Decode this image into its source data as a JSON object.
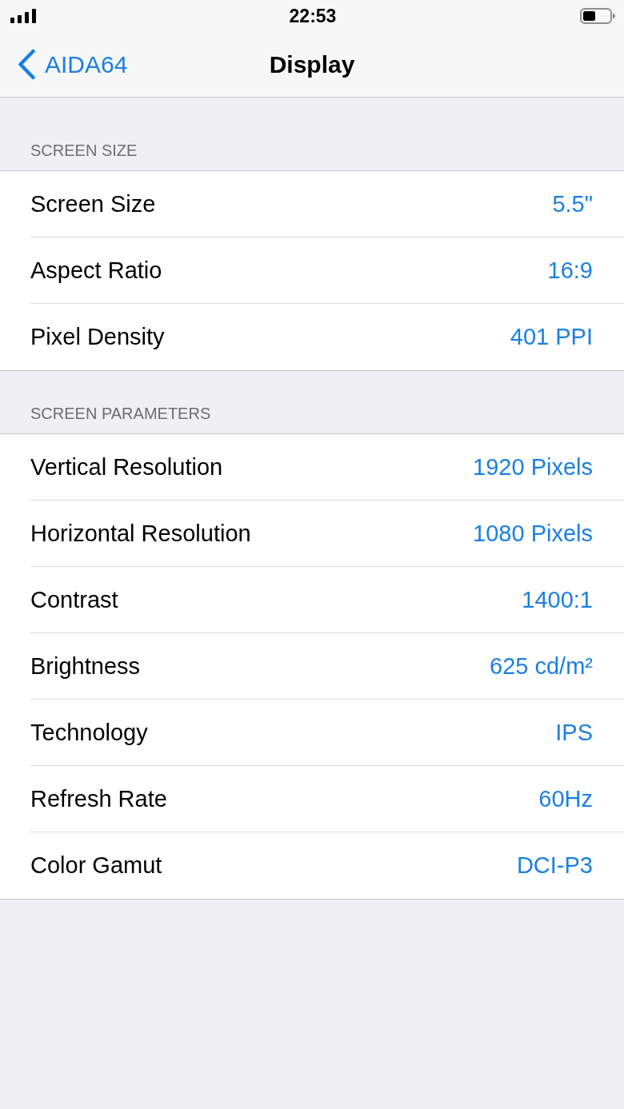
{
  "status_bar": {
    "time": "22:53"
  },
  "nav_bar": {
    "back_label": "AIDA64",
    "title": "Display"
  },
  "sections": [
    {
      "header": "SCREEN SIZE",
      "rows": [
        {
          "label": "Screen Size",
          "value": "5.5\""
        },
        {
          "label": "Aspect Ratio",
          "value": "16:9"
        },
        {
          "label": "Pixel Density",
          "value": "401 PPI"
        }
      ]
    },
    {
      "header": "SCREEN PARAMETERS",
      "rows": [
        {
          "label": "Vertical Resolution",
          "value": "1920 Pixels"
        },
        {
          "label": "Horizontal Resolution",
          "value": "1080 Pixels"
        },
        {
          "label": "Contrast",
          "value": "1400:1"
        },
        {
          "label": "Brightness",
          "value": "625 cd/m²"
        },
        {
          "label": "Technology",
          "value": "IPS"
        },
        {
          "label": "Refresh Rate",
          "value": "60Hz"
        },
        {
          "label": "Color Gamut",
          "value": "DCI-P3"
        }
      ]
    }
  ]
}
